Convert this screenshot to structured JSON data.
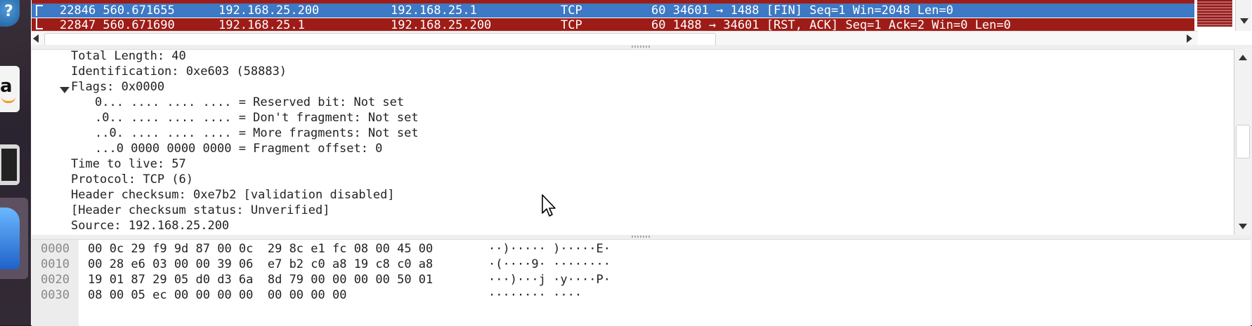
{
  "packet_list": {
    "rows": [
      {
        "no_time": "22846 560.671655",
        "source": "192.168.25.200",
        "destination": "192.168.25.1",
        "protocol": "TCP",
        "info": "60 34601 → 1488 [FIN] Seq=1 Win=2048 Len=0"
      },
      {
        "no_time": "22847 560.671690",
        "source": "192.168.25.1",
        "destination": "192.168.25.200",
        "protocol": "TCP",
        "info": "60 1488 → 34601 [RST, ACK] Seq=1 Ack=2 Win=0 Len=0"
      }
    ]
  },
  "details": {
    "lines": [
      "Total Length: 40",
      "Identification: 0xe603 (58883)",
      "Flags: 0x0000",
      "0... .... .... .... = Reserved bit: Not set",
      ".0.. .... .... .... = Don't fragment: Not set",
      "..0. .... .... .... = More fragments: Not set",
      "...0 0000 0000 0000 = Fragment offset: 0",
      "Time to live: 57",
      "Protocol: TCP (6)",
      "Header checksum: 0xe7b2 [validation disabled]",
      "[Header checksum status: Unverified]",
      "Source: 192.168.25.200"
    ]
  },
  "bytes": {
    "rows": [
      {
        "offset": "0000",
        "hex": "00 0c 29 f9 9d 87 00 0c  29 8c e1 fc 08 00 45 00",
        "ascii": "··)····· )·····E·"
      },
      {
        "offset": "0010",
        "hex": "00 28 e6 03 00 00 39 06  e7 b2 c0 a8 19 c8 c0 a8",
        "ascii": "·(····9· ········"
      },
      {
        "offset": "0020",
        "hex": "19 01 87 29 05 d0 d3 6a  8d 79 00 00 00 00 50 01",
        "ascii": "···)···j ·y····P·"
      },
      {
        "offset": "0030",
        "hex": "08 00 05 ec 00 00 00 00  00 00 00 00",
        "ascii": "········ ····"
      }
    ]
  },
  "launcher": {
    "items": [
      "help-icon",
      "amazon-icon",
      "terminal-icon",
      "wireshark-icon"
    ]
  },
  "colors": {
    "selected_row": "#3d79c4",
    "rst_row": "#9e1c17",
    "pane_bg": "#ffffff",
    "offset_gutter": "#ececec"
  }
}
